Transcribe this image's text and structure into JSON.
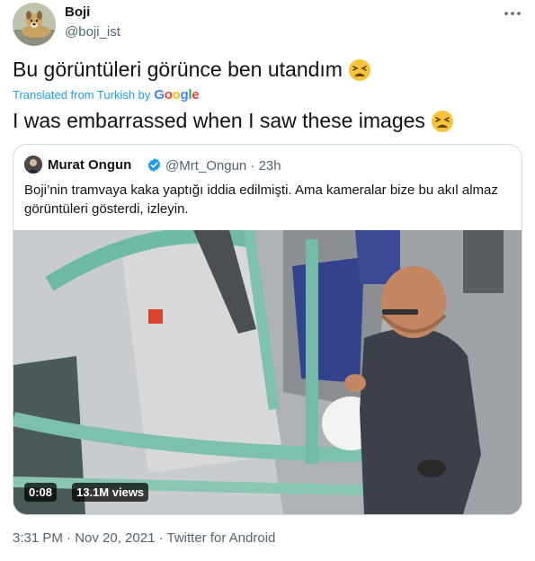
{
  "author": {
    "display_name": "Boji",
    "handle": "@boji_ist"
  },
  "more_icon": "ellipsis-icon",
  "tweet": {
    "original_text": "Bu görüntüleri görünce ben utandım",
    "translated_label": "Translated from Turkish by",
    "translator": "Google",
    "translated_text": "I was embarrassed when I saw these images",
    "emoji": "tired-face-emoji"
  },
  "quoted_tweet": {
    "name": "Murat Ongun",
    "handle_time": "@Mrt_Ongun · 23h",
    "verified": true,
    "text": "Boji’nin tramvaya kaka yaptığı iddia edilmişti. Ama kameralar bize bu akıl almaz görüntüleri gösterdi, izleyin.",
    "video": {
      "duration": "0:08",
      "views": "13.1M views"
    }
  },
  "footer": {
    "timestamp": "3:31 PM · Nov 20, 2021 · Twitter for Android"
  },
  "colors": {
    "link_blue": "#1d9bf0",
    "secondary_text": "#536471",
    "border": "#cfd9de"
  }
}
